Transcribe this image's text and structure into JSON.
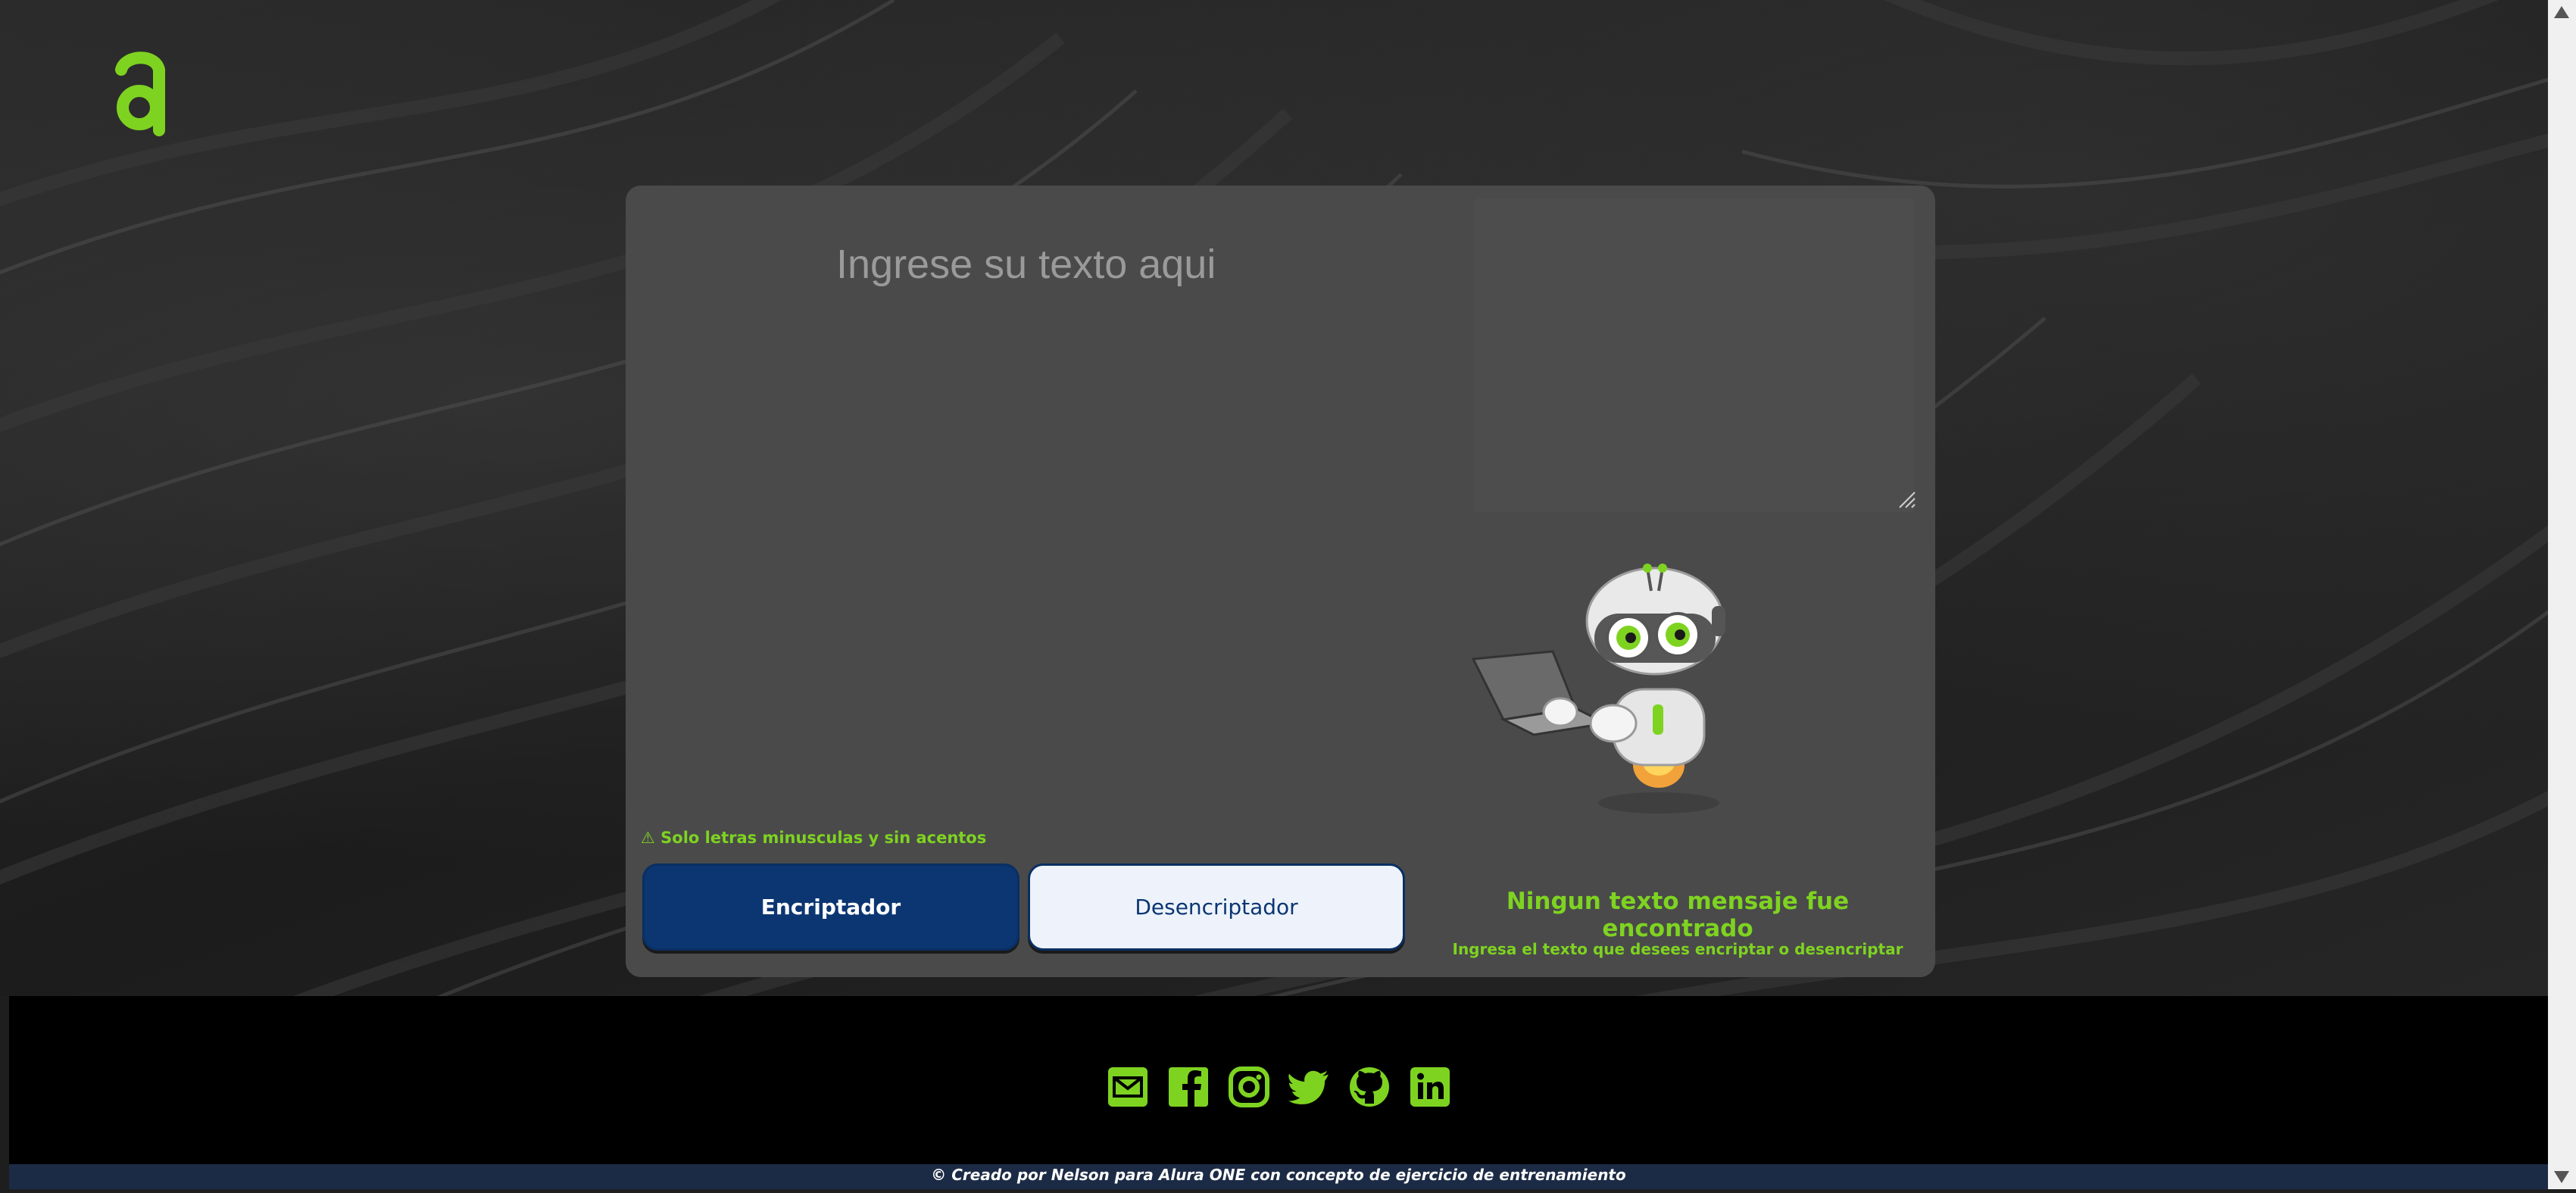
{
  "brand": {
    "logo_icon": "alura-logo-icon",
    "accent": "#7ed321"
  },
  "input": {
    "placeholder": "Ingrese su texto aqui"
  },
  "hint": {
    "text": "⚠ Solo letras minusculas y sin acentos"
  },
  "buttons": {
    "encrypt_label": "Encriptador",
    "decrypt_label": "Desencriptador"
  },
  "output": {
    "title": "Ningun texto mensaje fue encontrado",
    "subtitle": "Ingresa el texto que desees encriptar o desencriptar",
    "illustration": "robot-laptop-illustration"
  },
  "footer": {
    "social_icons": [
      "email-icon",
      "facebook-icon",
      "instagram-icon",
      "twitter-icon",
      "github-icon",
      "linkedin-icon"
    ],
    "copyright": "© Creado por Nelson para Alura ONE con concepto de ejercicio de entrenamiento"
  },
  "colors": {
    "primary_button": "#0b3672",
    "secondary_button": "#eef3fb",
    "card": "#4a4a4a",
    "footer": "#000000",
    "copyright_bar": "#1c2b45"
  }
}
